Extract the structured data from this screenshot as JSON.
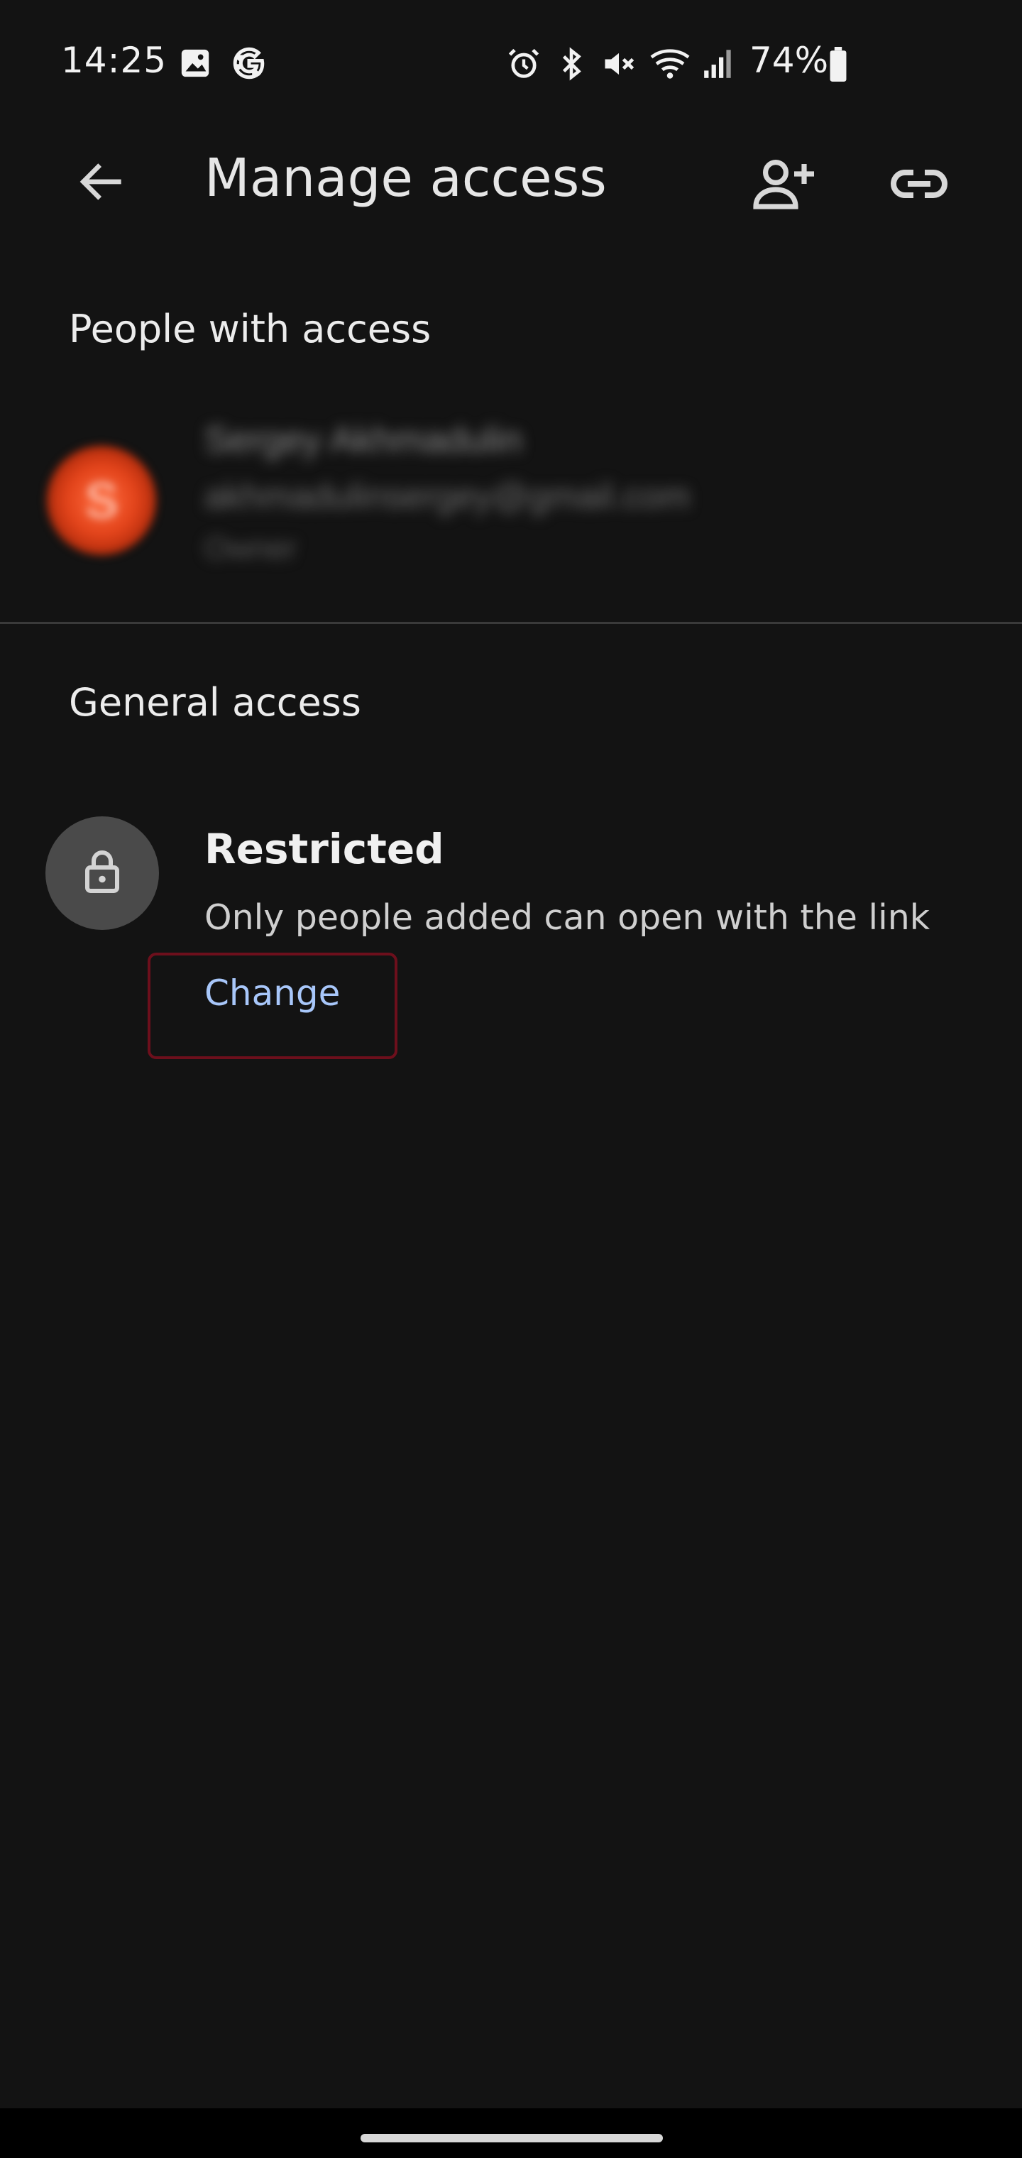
{
  "status_bar": {
    "time": "14:25",
    "battery": "74%",
    "left_icons": [
      "gallery-icon",
      "google-icon"
    ],
    "right_icons": [
      "alarm-icon",
      "bluetooth-icon",
      "mute-icon",
      "wifi-icon",
      "signal-icon",
      "battery-icon"
    ]
  },
  "app_bar": {
    "title": "Manage access",
    "back_icon": "arrow-back-icon",
    "actions": [
      "add-person-icon",
      "link-icon"
    ]
  },
  "people_section": {
    "title": "People with access",
    "people": [
      {
        "initial": "S",
        "name": "Sergey Akhmadulin",
        "email": "akhmadulinsergey@gmail.com",
        "role": "Owner",
        "avatar_color": "#e2431a"
      }
    ]
  },
  "general_access": {
    "title": "General access",
    "level": "Restricted",
    "description": "Only people added can open with the link",
    "change_label": "Change",
    "icon": "lock-icon",
    "highlight_color": "#6d0f1c",
    "link_color": "#a8c7fa"
  },
  "colors": {
    "background": "#131313",
    "text_primary": "#e3e3e3"
  }
}
